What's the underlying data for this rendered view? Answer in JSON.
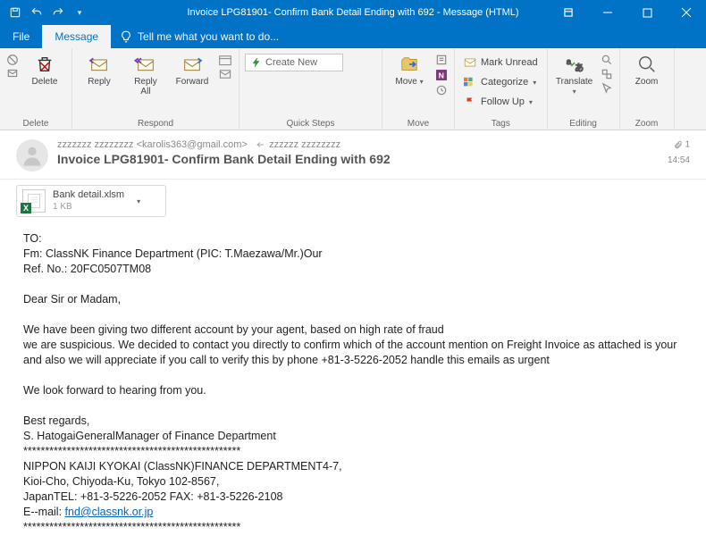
{
  "window": {
    "title": "Invoice LPG81901- Confirm Bank Detail Ending with 692 - Message (HTML)"
  },
  "tabs": {
    "file": "File",
    "message": "Message",
    "tellme": "Tell me what you want to do..."
  },
  "ribbon": {
    "delete": {
      "delete": "Delete",
      "group": "Delete"
    },
    "respond": {
      "reply": "Reply",
      "replyall": "Reply\nAll",
      "forward": "Forward",
      "group": "Respond"
    },
    "quick": {
      "create": "Create New",
      "group": "Quick Steps"
    },
    "move": {
      "move": "Move",
      "group": "Move"
    },
    "tags": {
      "unread": "Mark Unread",
      "categorize": "Categorize",
      "followup": "Follow Up",
      "group": "Tags"
    },
    "editing": {
      "translate": "Translate",
      "group": "Editing"
    },
    "zoom": {
      "zoom": "Zoom",
      "group": "Zoom"
    }
  },
  "header": {
    "from": "zzzzzzz zzzzzzzz <karolis363@gmail.com>",
    "to": "zzzzzz zzzzzzzz",
    "subject": "Invoice LPG81901- Confirm Bank Detail Ending with 692",
    "attcount": "1",
    "time": "14:54"
  },
  "attachment": {
    "name": "Bank detail.xlsm",
    "size": "1 KB"
  },
  "body": {
    "l1": "TO:",
    "l2": "Fm: ClassNK Finance Department (PIC: T.Maezawa/Mr.)Our",
    "l3": "Ref. No.: 20FC0507TM08",
    "l4": "Dear Sir or Madam,",
    "l5": "We have been giving two different account by your agent, based on high rate of fraud",
    "l6": "we are suspicious. We decided to contact you directly to confirm which of the account mention on Freight Invoice as attached is your",
    "l7": "and also we will appreciate if you call to verify this by phone  +81-3-5226-2052  handle  this emails as urgent",
    "l8": "We look forward to hearing from you.",
    "l9": "Best regards,",
    "l10": "S. HatogaiGeneralManager of Finance Department",
    "l11": "**************************************************",
    "l12": "NIPPON KAIJI KYOKAI (ClassNK)FINANCE DEPARTMENT4-7,",
    "l13": "Kioi-Cho, Chiyoda-Ku, Tokyo 102-8567,",
    "l14": "JapanTEL: +81-3-5226-2052 FAX: +81-3-5226-2108",
    "l15a": "E--mail: ",
    "l15b": "fnd@classnk.or.jp",
    "l16": "**************************************************"
  }
}
